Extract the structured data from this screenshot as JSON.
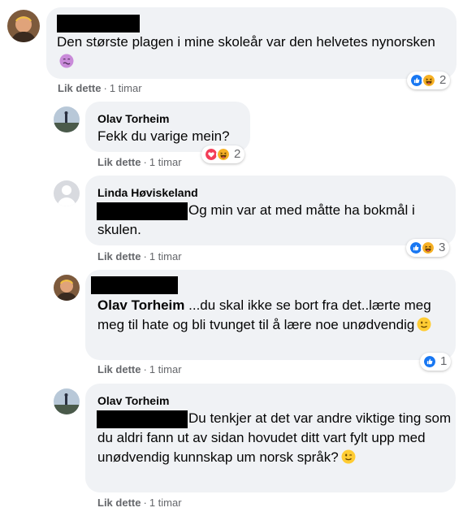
{
  "colors": {
    "bubble": "#f0f2f5",
    "meta_text": "#65676b",
    "like_blue": "#1877f2",
    "love_red": "#f33e58",
    "haha_yellow": "#f7b125"
  },
  "comments": [
    {
      "author": "",
      "author_redacted": true,
      "text": "Den største plagen i mine skoleår var den helvetes nynorsken",
      "emoji": "nauseated-face-icon",
      "like_label": "Lik dette",
      "time": "1 timar",
      "reactions": {
        "icons": [
          "like-icon",
          "haha-icon"
        ],
        "count": "2"
      }
    },
    {
      "author": "Olav Torheim",
      "text": "Fekk du varige mein?",
      "like_label": "Lik dette",
      "time": "1 timar",
      "reactions": {
        "icons": [
          "love-icon",
          "haha-icon"
        ],
        "count": "2"
      }
    },
    {
      "author": "Linda Høviskeland",
      "mention_redacted": true,
      "text": "Og min var at med måtte ha bokmål i skulen.",
      "like_label": "Lik dette",
      "time": "1 timar",
      "reactions": {
        "icons": [
          "like-icon",
          "haha-icon"
        ],
        "count": "3"
      }
    },
    {
      "author": "",
      "author_redacted": true,
      "mention": "Olav Torheim",
      "text": "...du skal ikke se bort fra det..lærte meg meg til hate og bli tvunget til å lære noe unødvendig",
      "emoji": "winking-face-icon",
      "like_label": "Lik dette",
      "time": "1 timar",
      "reactions": {
        "icons": [
          "like-icon"
        ],
        "count": "1"
      }
    },
    {
      "author": "Olav Torheim",
      "mention_redacted": true,
      "text": "Du tenkjer at det var andre viktige ting som du aldri fann ut av sidan hovudet ditt vart fylt upp med unødvendig kunnskap um norsk språk?",
      "emoji": "winking-face-icon",
      "like_label": "Lik dette",
      "time": "1 timar"
    }
  ]
}
